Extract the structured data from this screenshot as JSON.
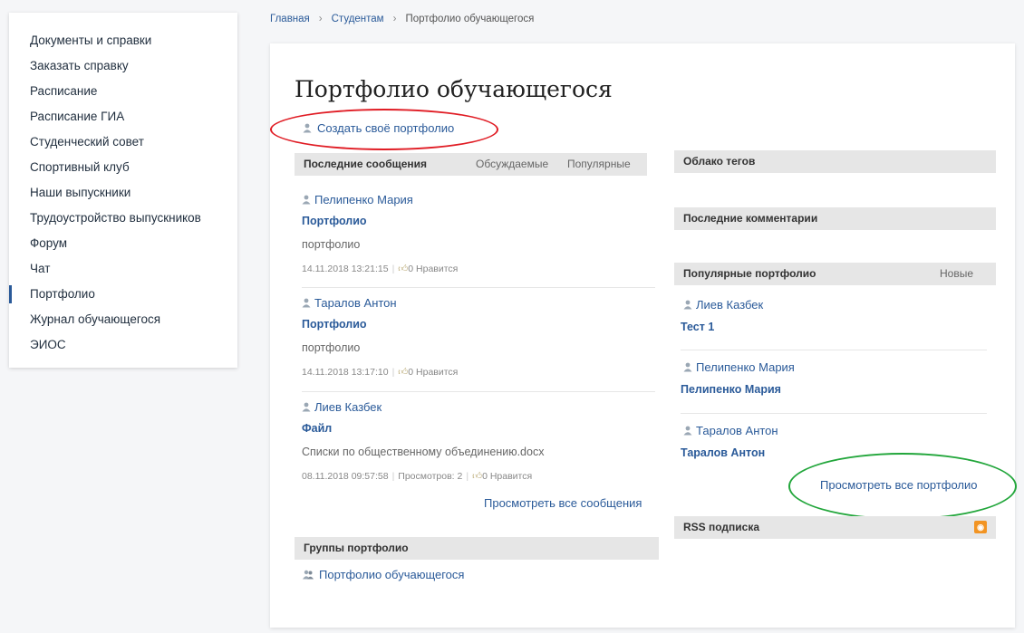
{
  "sidebar": {
    "items": [
      {
        "label": "Документы и справки"
      },
      {
        "label": "Заказать справку"
      },
      {
        "label": "Расписание"
      },
      {
        "label": "Расписание ГИА"
      },
      {
        "label": "Студенческий совет"
      },
      {
        "label": "Спортивный клуб"
      },
      {
        "label": "Наши выпускники"
      },
      {
        "label": "Трудоустройство выпускников"
      },
      {
        "label": "Форум"
      },
      {
        "label": "Чат"
      },
      {
        "label": "Портфолио"
      },
      {
        "label": "Журнал обучающегося"
      },
      {
        "label": "ЭИОС"
      }
    ],
    "active": "Портфолио"
  },
  "breadcrumb": {
    "items": [
      "Главная",
      "Студентам",
      "Портфолио обучающегося"
    ],
    "separator": "›"
  },
  "main": {
    "title": "Портфолио обучающегося",
    "create_link": "Создать своё портфолио",
    "messages": {
      "header": "Последние сообщения",
      "tab_discussed": "Обсуждаемые",
      "tab_popular": "Популярные",
      "posts": [
        {
          "author": "Пелипенко Мария",
          "title": "Портфолио",
          "desc": "портфолио",
          "date": "14.11.2018 13:21:15",
          "views": "",
          "likes": "0 Нравится"
        },
        {
          "author": "Таралов Антон",
          "title": "Портфолио",
          "desc": "портфолио",
          "date": "14.11.2018 13:17:10",
          "views": "",
          "likes": "0 Нравится"
        },
        {
          "author": "Лиев Казбек",
          "title": "Файл",
          "desc": "Списки по общественному объединению.docx",
          "date": "08.11.2018 09:57:58",
          "views": "Просмотров: 2",
          "likes": "0 Нравится"
        }
      ],
      "view_all": "Просмотреть все сообщения"
    },
    "groups": {
      "header": "Группы портфолио",
      "item": "Портфолио обучающегося"
    },
    "tags": {
      "header": "Облако тегов"
    },
    "comments": {
      "header": "Последние комментарии"
    },
    "popular": {
      "header": "Популярные портфолио",
      "tab_new": "Новые",
      "items": [
        {
          "author": "Лиев Казбек",
          "title": "Тест 1"
        },
        {
          "author": "Пелипенко Мария",
          "title": "Пелипенко Мария"
        },
        {
          "author": "Таралов Антон",
          "title": "Таралов Антон"
        }
      ],
      "view_all": "Просмотреть все портфолио"
    },
    "rss": {
      "header": "RSS подписка"
    }
  },
  "icons": {
    "user": "user-icon",
    "group": "group-icon",
    "like": "thumbs-up-icon",
    "rss": "rss-icon"
  },
  "colors": {
    "link": "#2a5a99",
    "highlight_red": "#e01c24",
    "highlight_green": "#22a63b",
    "rss": "#f29423"
  }
}
